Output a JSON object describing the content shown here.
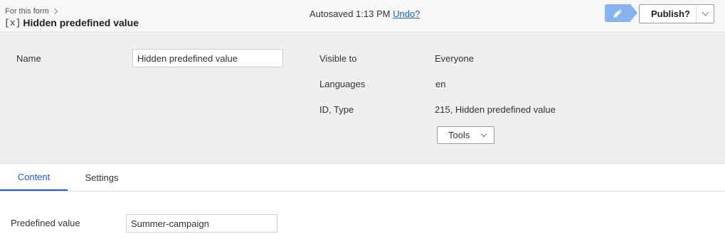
{
  "header": {
    "breadcrumb": "For this form",
    "block_badge": "[x]",
    "title": "Hidden predefined value",
    "autosave_text": "Autosaved 1:13 PM",
    "undo_label": "Undo?",
    "publish_label": "Publish?"
  },
  "properties": {
    "name_label": "Name",
    "name_value": "Hidden predefined value",
    "visible_to_label": "Visible to",
    "visible_to_value": "Everyone",
    "languages_label": "Languages",
    "languages_value": "en",
    "id_type_label": "ID, Type",
    "id_type_value": "215, Hidden predefined value",
    "tools_label": "Tools"
  },
  "tabs": [
    {
      "label": "Content",
      "active": true
    },
    {
      "label": "Settings",
      "active": false
    }
  ],
  "content": {
    "predefined_value_label": "Predefined value",
    "predefined_value": "Summer-campaign"
  },
  "colors": {
    "accent": "#1a5fc7",
    "edit_button": "#86b4f0"
  }
}
